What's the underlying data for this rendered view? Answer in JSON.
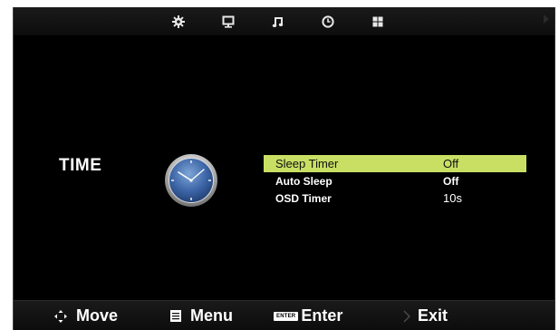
{
  "topbar": {
    "tabs": [
      {
        "icon": "gear-icon"
      },
      {
        "icon": "monitor-icon"
      },
      {
        "icon": "music-note-icon"
      },
      {
        "icon": "clock-icon"
      },
      {
        "icon": "grid-icon"
      }
    ]
  },
  "page": {
    "title": "TIME",
    "icon": "analog-clock-icon"
  },
  "menu": {
    "items": [
      {
        "label": "Sleep Timer",
        "value": "Off",
        "selected": true
      },
      {
        "label": "Auto Sleep",
        "value": "Off",
        "selected": false
      },
      {
        "label": "OSD Timer",
        "value": "10s",
        "selected": false
      }
    ]
  },
  "footer": {
    "move": "Move",
    "menu": "Menu",
    "enter_key": "ENTER",
    "enter": "Enter",
    "exit": "Exit"
  },
  "colors": {
    "highlight": "#c9df64",
    "background": "#000000"
  }
}
